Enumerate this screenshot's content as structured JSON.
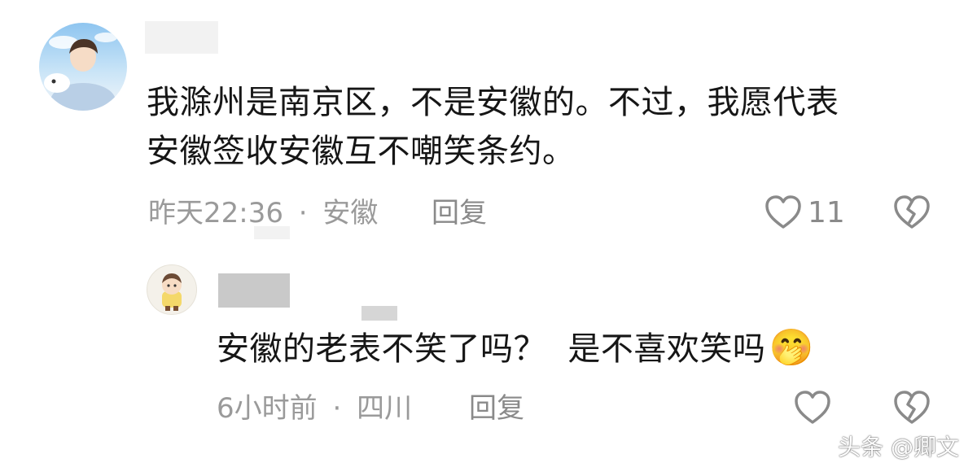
{
  "comment": {
    "text_line1": "我滁州是南京区，不是安徽的。不过，我愿代表",
    "text_line2": "安徽签收安徽互不嘲笑条约。",
    "time": "昨天22:36",
    "separator": "·",
    "location": "安徽",
    "reply_label": "回复",
    "like_count": "11",
    "like_icon": "heart-outline-icon",
    "dislike_icon": "broken-heart-icon"
  },
  "reply": {
    "text": "安徽的老表不笑了吗？  是不喜欢笑吗",
    "emoji": "🤭",
    "time": "6小时前",
    "separator": "·",
    "location": "四川",
    "reply_label": "回复",
    "like_icon": "heart-outline-icon",
    "dislike_icon": "broken-heart-icon"
  },
  "watermark": "头条 @卿文",
  "colors": {
    "text": "#161616",
    "meta": "#9a9a9a",
    "icon": "#8a8a8a"
  }
}
